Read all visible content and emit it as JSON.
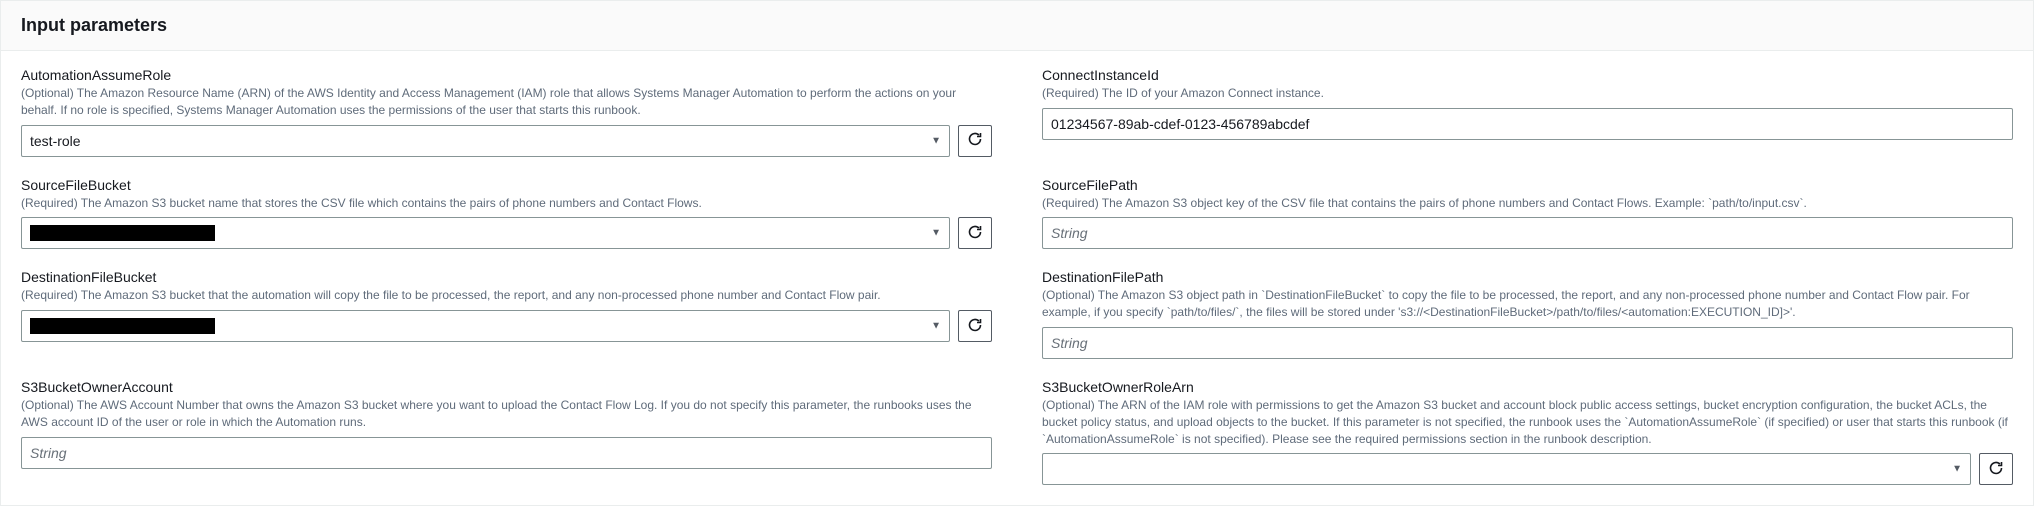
{
  "panel": {
    "title": "Input parameters"
  },
  "fields": {
    "automationAssumeRole": {
      "label": "AutomationAssumeRole",
      "desc": "(Optional) The Amazon Resource Name (ARN) of the AWS Identity and Access Management (IAM) role that allows Systems Manager Automation to perform the actions on your behalf. If no role is specified, Systems Manager Automation uses the permissions of the user that starts this runbook.",
      "value": "test-role"
    },
    "connectInstanceId": {
      "label": "ConnectInstanceId",
      "desc": "(Required) The ID of your Amazon Connect instance.",
      "value": "01234567-89ab-cdef-0123-456789abcdef"
    },
    "sourceFileBucket": {
      "label": "SourceFileBucket",
      "desc": "(Required) The Amazon S3 bucket name that stores the CSV file which contains the pairs of phone numbers and Contact Flows."
    },
    "sourceFilePath": {
      "label": "SourceFilePath",
      "desc": "(Required) The Amazon S3 object key of the CSV file that contains the pairs of phone numbers and Contact Flows. Example: `path/to/input.csv`.",
      "placeholder": "String"
    },
    "destinationFileBucket": {
      "label": "DestinationFileBucket",
      "desc": "(Required) The Amazon S3 bucket that the automation will copy the file to be processed, the report, and any non-processed phone number and Contact Flow pair."
    },
    "destinationFilePath": {
      "label": "DestinationFilePath",
      "desc": "(Optional) The Amazon S3 object path in `DestinationFileBucket` to copy the file to be processed, the report, and any non-processed phone number and Contact Flow pair. For example, if you specify `path/to/files/`, the files will be stored under 's3://<DestinationFileBucket>/path/to/files/<automation:EXECUTION_ID]>'.",
      "placeholder": "String"
    },
    "s3BucketOwnerAccount": {
      "label": "S3BucketOwnerAccount",
      "desc": "(Optional) The AWS Account Number that owns the Amazon S3 bucket where you want to upload the Contact Flow Log. If you do not specify this parameter, the runbooks uses the AWS account ID of the user or role in which the Automation runs.",
      "placeholder": "String"
    },
    "s3BucketOwnerRoleArn": {
      "label": "S3BucketOwnerRoleArn",
      "desc": "(Optional) The ARN of the IAM role with permissions to get the Amazon S3 bucket and account block public access settings, bucket encryption configuration, the bucket ACLs, the bucket policy status, and upload objects to the bucket. If this parameter is not specified, the runbook uses the `AutomationAssumeRole` (if specified) or user that starts this runbook (if `AutomationAssumeRole` is not specified). Please see the required permissions section in the runbook description."
    }
  }
}
